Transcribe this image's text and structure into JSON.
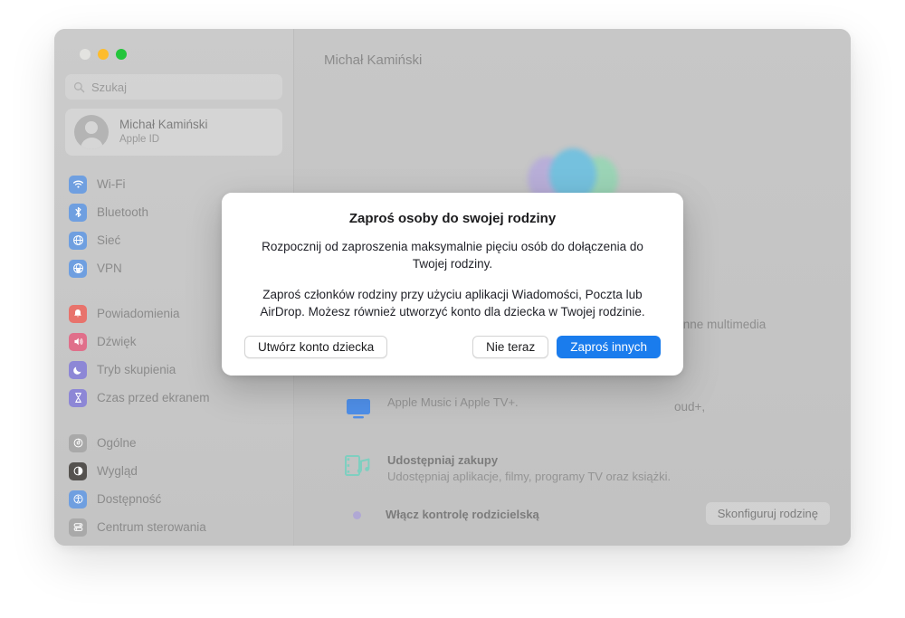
{
  "window": {
    "traffic_lights": [
      {
        "name": "close",
        "color": "#e3e3e0"
      },
      {
        "name": "minimize",
        "color": "#fdbc2c"
      },
      {
        "name": "maximize",
        "color": "#23c53b"
      }
    ]
  },
  "sidebar": {
    "search": {
      "placeholder": "Szukaj",
      "icon": "search-icon"
    },
    "account": {
      "name": "Michał Kamiński",
      "subtitle": "Apple ID",
      "avatar_icon": "person-avatar-icon"
    },
    "groups": [
      {
        "items": [
          {
            "label": "Wi-Fi",
            "icon": "wifi-icon",
            "color": "#6f9fe0"
          },
          {
            "label": "Bluetooth",
            "icon": "bluetooth-icon",
            "color": "#6f9fe0"
          },
          {
            "label": "Sieć",
            "icon": "globe-icon",
            "color": "#6f9fe0"
          },
          {
            "label": "VPN",
            "icon": "vpn-globe-icon",
            "color": "#6f9fe0"
          }
        ]
      },
      {
        "items": [
          {
            "label": "Powiadomienia",
            "icon": "bell-icon",
            "color": "#e8736c"
          },
          {
            "label": "Dźwięk",
            "icon": "speaker-icon",
            "color": "#e06f8a"
          },
          {
            "label": "Tryb skupienia",
            "icon": "moon-icon",
            "color": "#8d87d6"
          },
          {
            "label": "Czas przed ekranem",
            "icon": "hourglass-icon",
            "color": "#8d87d6"
          }
        ]
      },
      {
        "items": [
          {
            "label": "Ogólne",
            "icon": "gear-icon",
            "color": "#a9a9a9"
          },
          {
            "label": "Wygląd",
            "icon": "appearance-icon",
            "color": "#55524f"
          },
          {
            "label": "Dostępność",
            "icon": "accessibility-icon",
            "color": "#6f9fe0"
          },
          {
            "label": "Centrum sterowania",
            "icon": "control-center-icon",
            "color": "#a9a9a9"
          }
        ]
      }
    ]
  },
  "content": {
    "title": "Michał Kamiński",
    "family_art_icon": "family-group-icon",
    "background_lines": [
      "i inne multimedia",
      "oud+,"
    ],
    "features": [
      {
        "name": "media-sharing",
        "icon": "media-share-icon",
        "title": "",
        "subtitle": "Apple Music i Apple TV+."
      },
      {
        "name": "purchase-sharing",
        "icon": "film-music-icon",
        "title": "Udostępniaj zakupy",
        "subtitle": "Udostępniaj aplikacje, filmy, programy TV oraz książki."
      },
      {
        "name": "parental-controls",
        "icon": "dot-icon",
        "title": "Włącz kontrolę rodzicielską",
        "subtitle": ""
      }
    ],
    "setup_button": "Skonfiguruj rodzinę"
  },
  "modal": {
    "title": "Zaproś osoby do swojej rodziny",
    "paragraph1": "Rozpocznij od zaproszenia maksymalnie pięciu osób do dołączenia do Twojej rodziny.",
    "paragraph2": "Zaproś członków rodziny przy użyciu aplikacji Wiadomości, Poczta lub AirDrop. Możesz również utworzyć konto dla dziecka w Twojej rodzinie.",
    "buttons": {
      "create_child": "Utwórz konto dziecka",
      "not_now": "Nie teraz",
      "invite_others": "Zaproś innych"
    },
    "accent_color": "#1a7ced"
  }
}
